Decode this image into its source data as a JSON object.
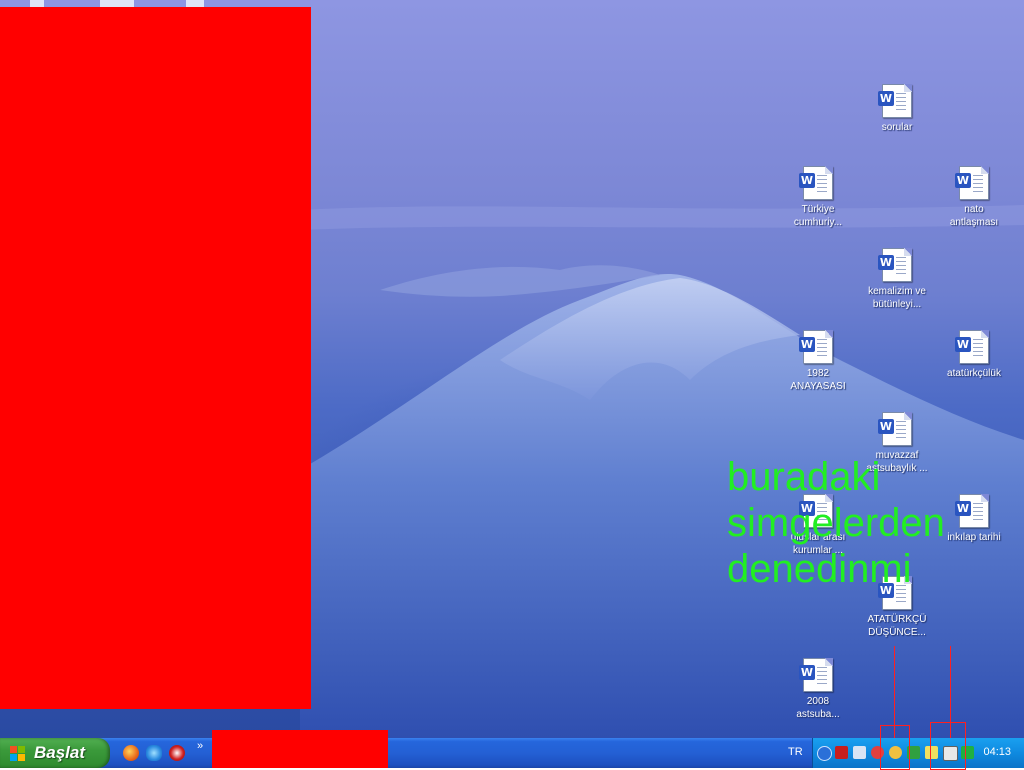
{
  "desktop": {
    "icons": [
      {
        "label": "sorular"
      },
      {
        "label": "Türkiye\ncumhuriy..."
      },
      {
        "label": "nato\nantlaşması"
      },
      {
        "label": "kemalizim ve\nbütünleyi..."
      },
      {
        "label": "1982\nANAYASASI"
      },
      {
        "label": "atatürkçülük"
      },
      {
        "label": "muvazzaf\nastsubaylık ..."
      },
      {
        "label": "uluslar arası\nkurumlar ..."
      },
      {
        "label": "inkılap tarihi"
      },
      {
        "label": "ATATÜRKÇÜ\nDÜŞÜNCE..."
      },
      {
        "label": "2008\nastsuba..."
      }
    ],
    "annotation": "buradaki\nsimgelerden\ndenedinmi"
  },
  "taskbar": {
    "start_label": "Başlat",
    "language": "TR",
    "clock": "04:13",
    "quick_launch_icons": [
      "firefox-icon",
      "internet-explorer-icon",
      "media-icon"
    ],
    "tray_icons": [
      "expand-icon",
      "acrobat-icon",
      "network-icon",
      "speaker-icon",
      "messenger-icon",
      "antivirus-icon",
      "update-icon",
      "security-icon",
      "display-icon",
      "green-arrow-icon"
    ]
  },
  "colors": {
    "redaction": "#ff0000",
    "annotation_text": "#22ee22",
    "taskbar": "#2460d4",
    "start_button": "#3b9a3b"
  }
}
